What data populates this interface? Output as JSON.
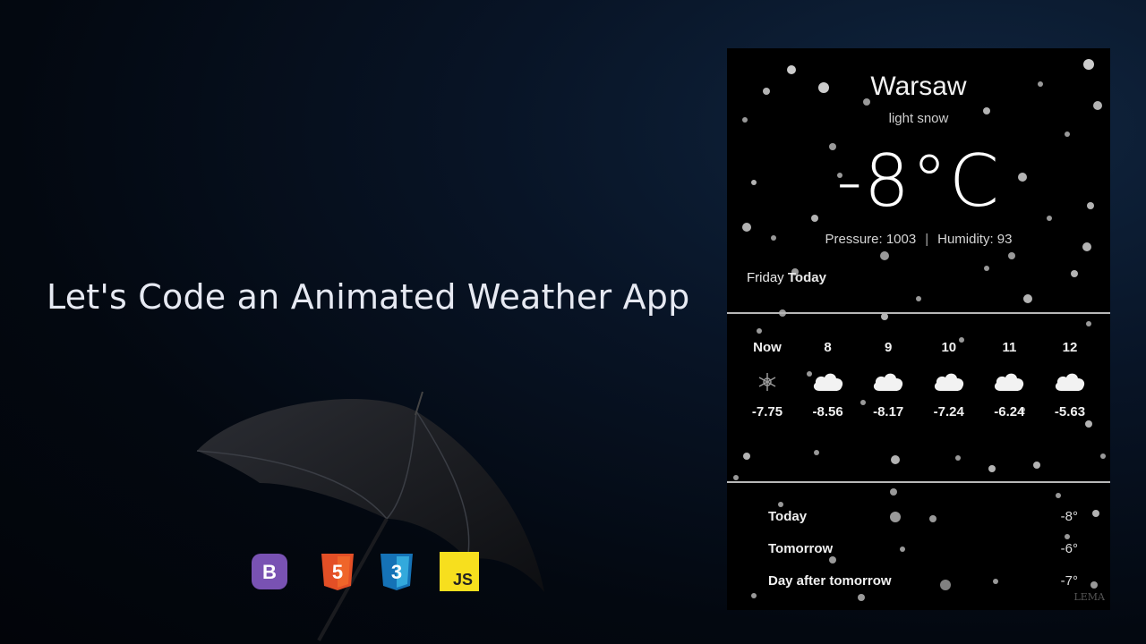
{
  "headline": "Let's Code an Animated Weather App",
  "tech_badges": [
    {
      "name": "bootstrap",
      "label": "B",
      "color": "#7952b3"
    },
    {
      "name": "html5",
      "label": "5",
      "color": "#e34f26"
    },
    {
      "name": "css3",
      "label": "3",
      "color": "#1572b6"
    },
    {
      "name": "javascript",
      "label": "JS",
      "color": "#f7df1e"
    }
  ],
  "weather": {
    "city": "Warsaw",
    "description": "light snow",
    "temperature": "-8°C",
    "pressure": "Pressure: 1003",
    "separator": "|",
    "humidity": "Humidity: 93",
    "day_name": "Friday",
    "day_label": "Today",
    "hourly": [
      {
        "time": "Now",
        "temp": "-7.75",
        "icon": "snowflake-icon"
      },
      {
        "time": "8",
        "temp": "-8.56",
        "icon": "cloud-icon"
      },
      {
        "time": "9",
        "temp": "-8.17",
        "icon": "cloud-icon"
      },
      {
        "time": "10",
        "temp": "-7.24",
        "icon": "cloud-icon"
      },
      {
        "time": "11",
        "temp": "-6.24",
        "icon": "cloud-icon"
      },
      {
        "time": "12",
        "temp": "-5.63",
        "icon": "cloud-icon"
      }
    ],
    "daily": [
      {
        "day": "Today",
        "temp": "-8°"
      },
      {
        "day": "Tomorrow",
        "temp": "-6°"
      },
      {
        "day": "Day after tomorrow",
        "temp": "-7°"
      }
    ],
    "watermark": "LEMA"
  }
}
